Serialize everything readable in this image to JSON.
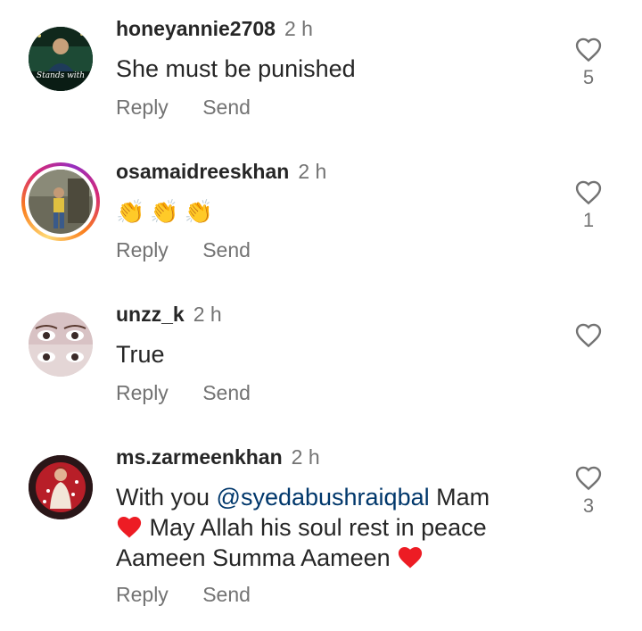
{
  "comments": [
    {
      "username": "honeyannie2708",
      "time": "2 h",
      "text": "She must be punished",
      "reply_label": "Reply",
      "send_label": "Send",
      "likes": "5",
      "avatar_caption": "Stands with"
    },
    {
      "username": "osamaidreeskhan",
      "time": "2 h",
      "text": "👏👏👏",
      "reply_label": "Reply",
      "send_label": "Send",
      "likes": "1"
    },
    {
      "username": "unzz_k",
      "time": "2 h",
      "text": "True",
      "reply_label": "Reply",
      "send_label": "Send",
      "likes": ""
    },
    {
      "username": "ms.zarmeenkhan",
      "time": "2 h",
      "text_part1": "With you ",
      "mention": "@syedabushraiqbal",
      "text_part2": " Mam",
      "text_part3": " May Allah his soul rest in peace",
      "text_part4": "Aameen Summa Aameen ",
      "reply_label": "Reply",
      "send_label": "Send",
      "likes": "3"
    }
  ],
  "colors": {
    "text": "#262626",
    "secondary": "#737373",
    "mention": "#00376b",
    "heart_red": "#ed1c24"
  }
}
